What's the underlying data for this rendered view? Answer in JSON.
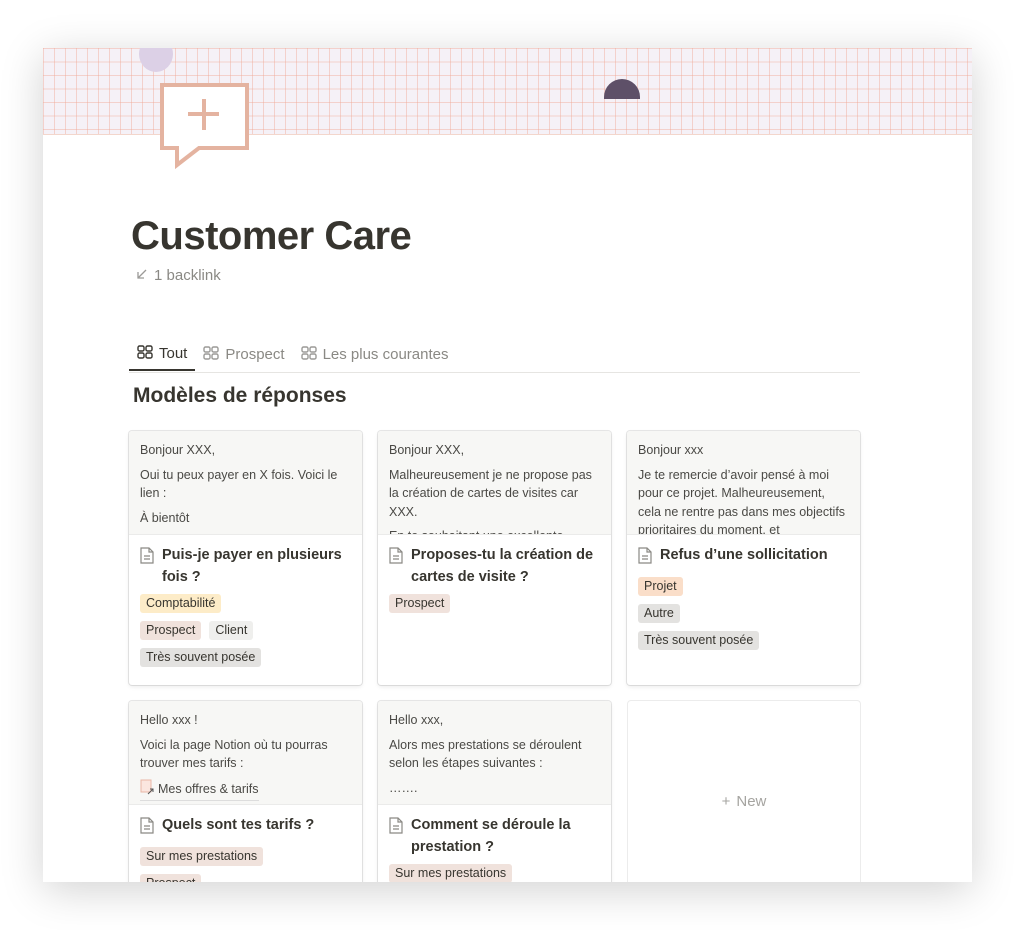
{
  "page": {
    "title": "Customer Care",
    "backlinks": "1 backlink"
  },
  "tabs": [
    {
      "label": "Tout",
      "active": true
    },
    {
      "label": "Prospect",
      "active": false
    },
    {
      "label": "Les plus courantes",
      "active": false
    }
  ],
  "section_title": "Modèles de réponses",
  "tag_colors": {
    "Comptabilité": "#fdecc8",
    "Prospect": "#f0e2dc",
    "Client": "#efefed",
    "Très souvent posée": "#e3e2e0",
    "Projet": "#fadec9",
    "Autre": "#e3e2e0",
    "Sur mes prestations": "#f0e2dc"
  },
  "cards": [
    {
      "preview": [
        "Bonjour XXX,",
        "Oui tu peux payer en X fois. Voici le lien :",
        "À bientôt"
      ],
      "title": "Puis-je payer en plusieurs fois ?",
      "tag_rows": [
        [
          "Comptabilité"
        ],
        [
          "Prospect",
          "Client"
        ],
        [
          "Très souvent posée"
        ]
      ]
    },
    {
      "preview": [
        "Bonjour XXX,",
        "Malheureusement je ne propose pas la création de cartes de visites car XXX.",
        "En te souhaitant une excellente"
      ],
      "title": "Proposes-tu la création de cartes de visite ?",
      "tag_rows": [
        [
          "Prospect"
        ]
      ]
    },
    {
      "preview": [
        "Bonjour xxx",
        "Je te remercie d’avoir pensé à moi pour ce projet. Malheureusement, cela ne rentre pas dans mes objectifs prioritaires du moment, et"
      ],
      "title": "Refus d’une sollicitation",
      "tag_rows": [
        [
          "Projet"
        ],
        [
          "Autre"
        ],
        [
          "Très souvent posée"
        ]
      ]
    },
    {
      "preview": [
        "Hello xxx !",
        "Voici la page Notion où tu pourras trouver mes tarifs :"
      ],
      "preview_link": "Mes offres & tarifs",
      "title": "Quels sont tes tarifs ?",
      "tag_rows": [
        [
          "Sur mes prestations"
        ],
        [
          "Prospect"
        ]
      ]
    },
    {
      "preview": [
        "Hello xxx,",
        "Alors mes prestations se déroulent selon les étapes suivantes :",
        "……."
      ],
      "title": "Comment se déroule la prestation ?",
      "tag_rows": [
        [
          "Sur mes prestations"
        ]
      ]
    }
  ],
  "new_label": "New",
  "colors": {
    "accent_icon": "#e4b3a0",
    "cover_grid": "#f0aa96",
    "cover_bg": "#f5f1f7"
  }
}
